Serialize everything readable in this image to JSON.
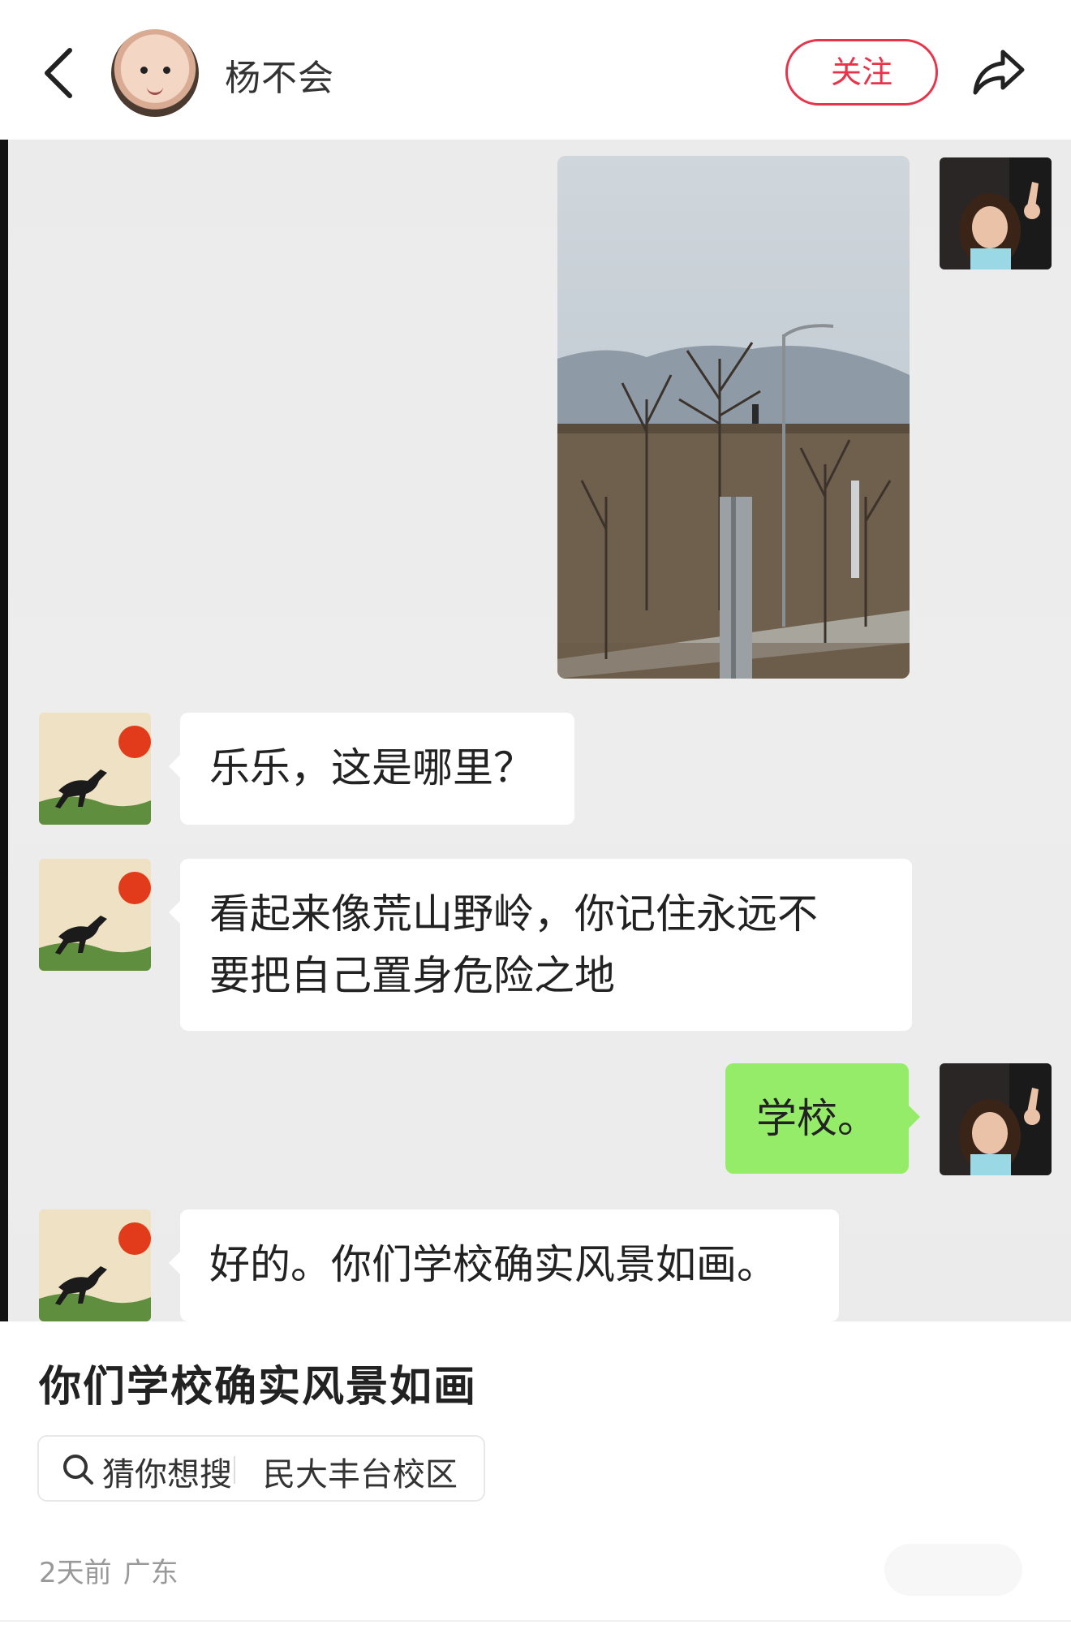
{
  "header": {
    "username": "杨不会",
    "follow_label": "关注",
    "icons": {
      "back": "chevron-left-icon",
      "share": "share-arrow-icon"
    }
  },
  "chat": {
    "messages": [
      {
        "side": "right",
        "type": "image",
        "content": "photo of school grounds with hills"
      },
      {
        "side": "left",
        "type": "text",
        "text": "乐乐，这是哪里？"
      },
      {
        "side": "left",
        "type": "text",
        "lines": [
          "看起来像荒山野岭，你记住永远不",
          "要把自己置身危险之地"
        ]
      },
      {
        "side": "right",
        "type": "text",
        "text": "学校。"
      },
      {
        "side": "left",
        "type": "text",
        "text": "好的。你们学校确实风景如画。"
      }
    ]
  },
  "post": {
    "title": "你们学校确实风景如画",
    "search_prefix": "猜你想搜",
    "search_term": "民大丰台校区",
    "time": "2天前",
    "location": "广东"
  },
  "colors": {
    "accent": "#e8334a",
    "bubble_green": "#95ec69",
    "chat_bg": "#ededed"
  }
}
